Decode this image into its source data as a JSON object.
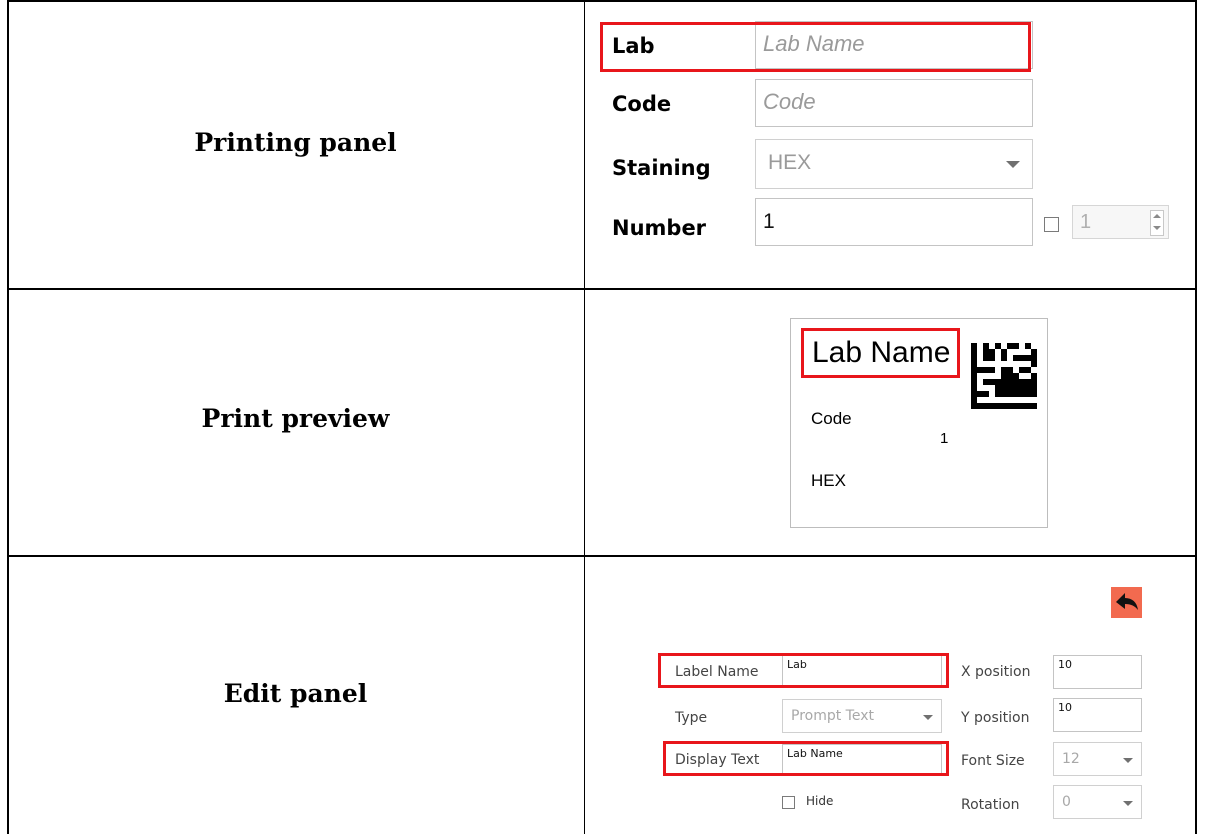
{
  "rows": {
    "printing_panel": "Printing panel",
    "print_preview": "Print preview",
    "edit_panel": "Edit panel"
  },
  "printing_panel": {
    "lab_label": "Lab",
    "lab_placeholder": "Lab Name",
    "code_label": "Code",
    "code_placeholder": "Code",
    "staining_label": "Staining",
    "staining_value": "HEX",
    "number_label": "Number",
    "number_value": "1",
    "copies_value": "1"
  },
  "preview": {
    "lab_name": "Lab Name",
    "code": "Code",
    "number": "1",
    "staining": "HEX"
  },
  "edit_panel": {
    "label_name_label": "Label Name",
    "label_name_value": "Lab",
    "type_label": "Type",
    "type_value": "Prompt Text",
    "display_text_label": "Display Text",
    "display_text_value": "Lab Name",
    "hide_label": "Hide",
    "x_position_label": "X position",
    "x_position_value": "10",
    "y_position_label": "Y position",
    "y_position_value": "10",
    "font_size_label": "Font Size",
    "font_size_value": "12",
    "rotation_label": "Rotation",
    "rotation_value": "0"
  },
  "icons": {
    "back": "back-arrow-icon",
    "dropdown": "chevron-down-icon",
    "spinner": "spinner-arrows-icon"
  },
  "colors": {
    "highlight": "#e8161b",
    "back_button": "#f26a4f",
    "border": "#000000"
  }
}
